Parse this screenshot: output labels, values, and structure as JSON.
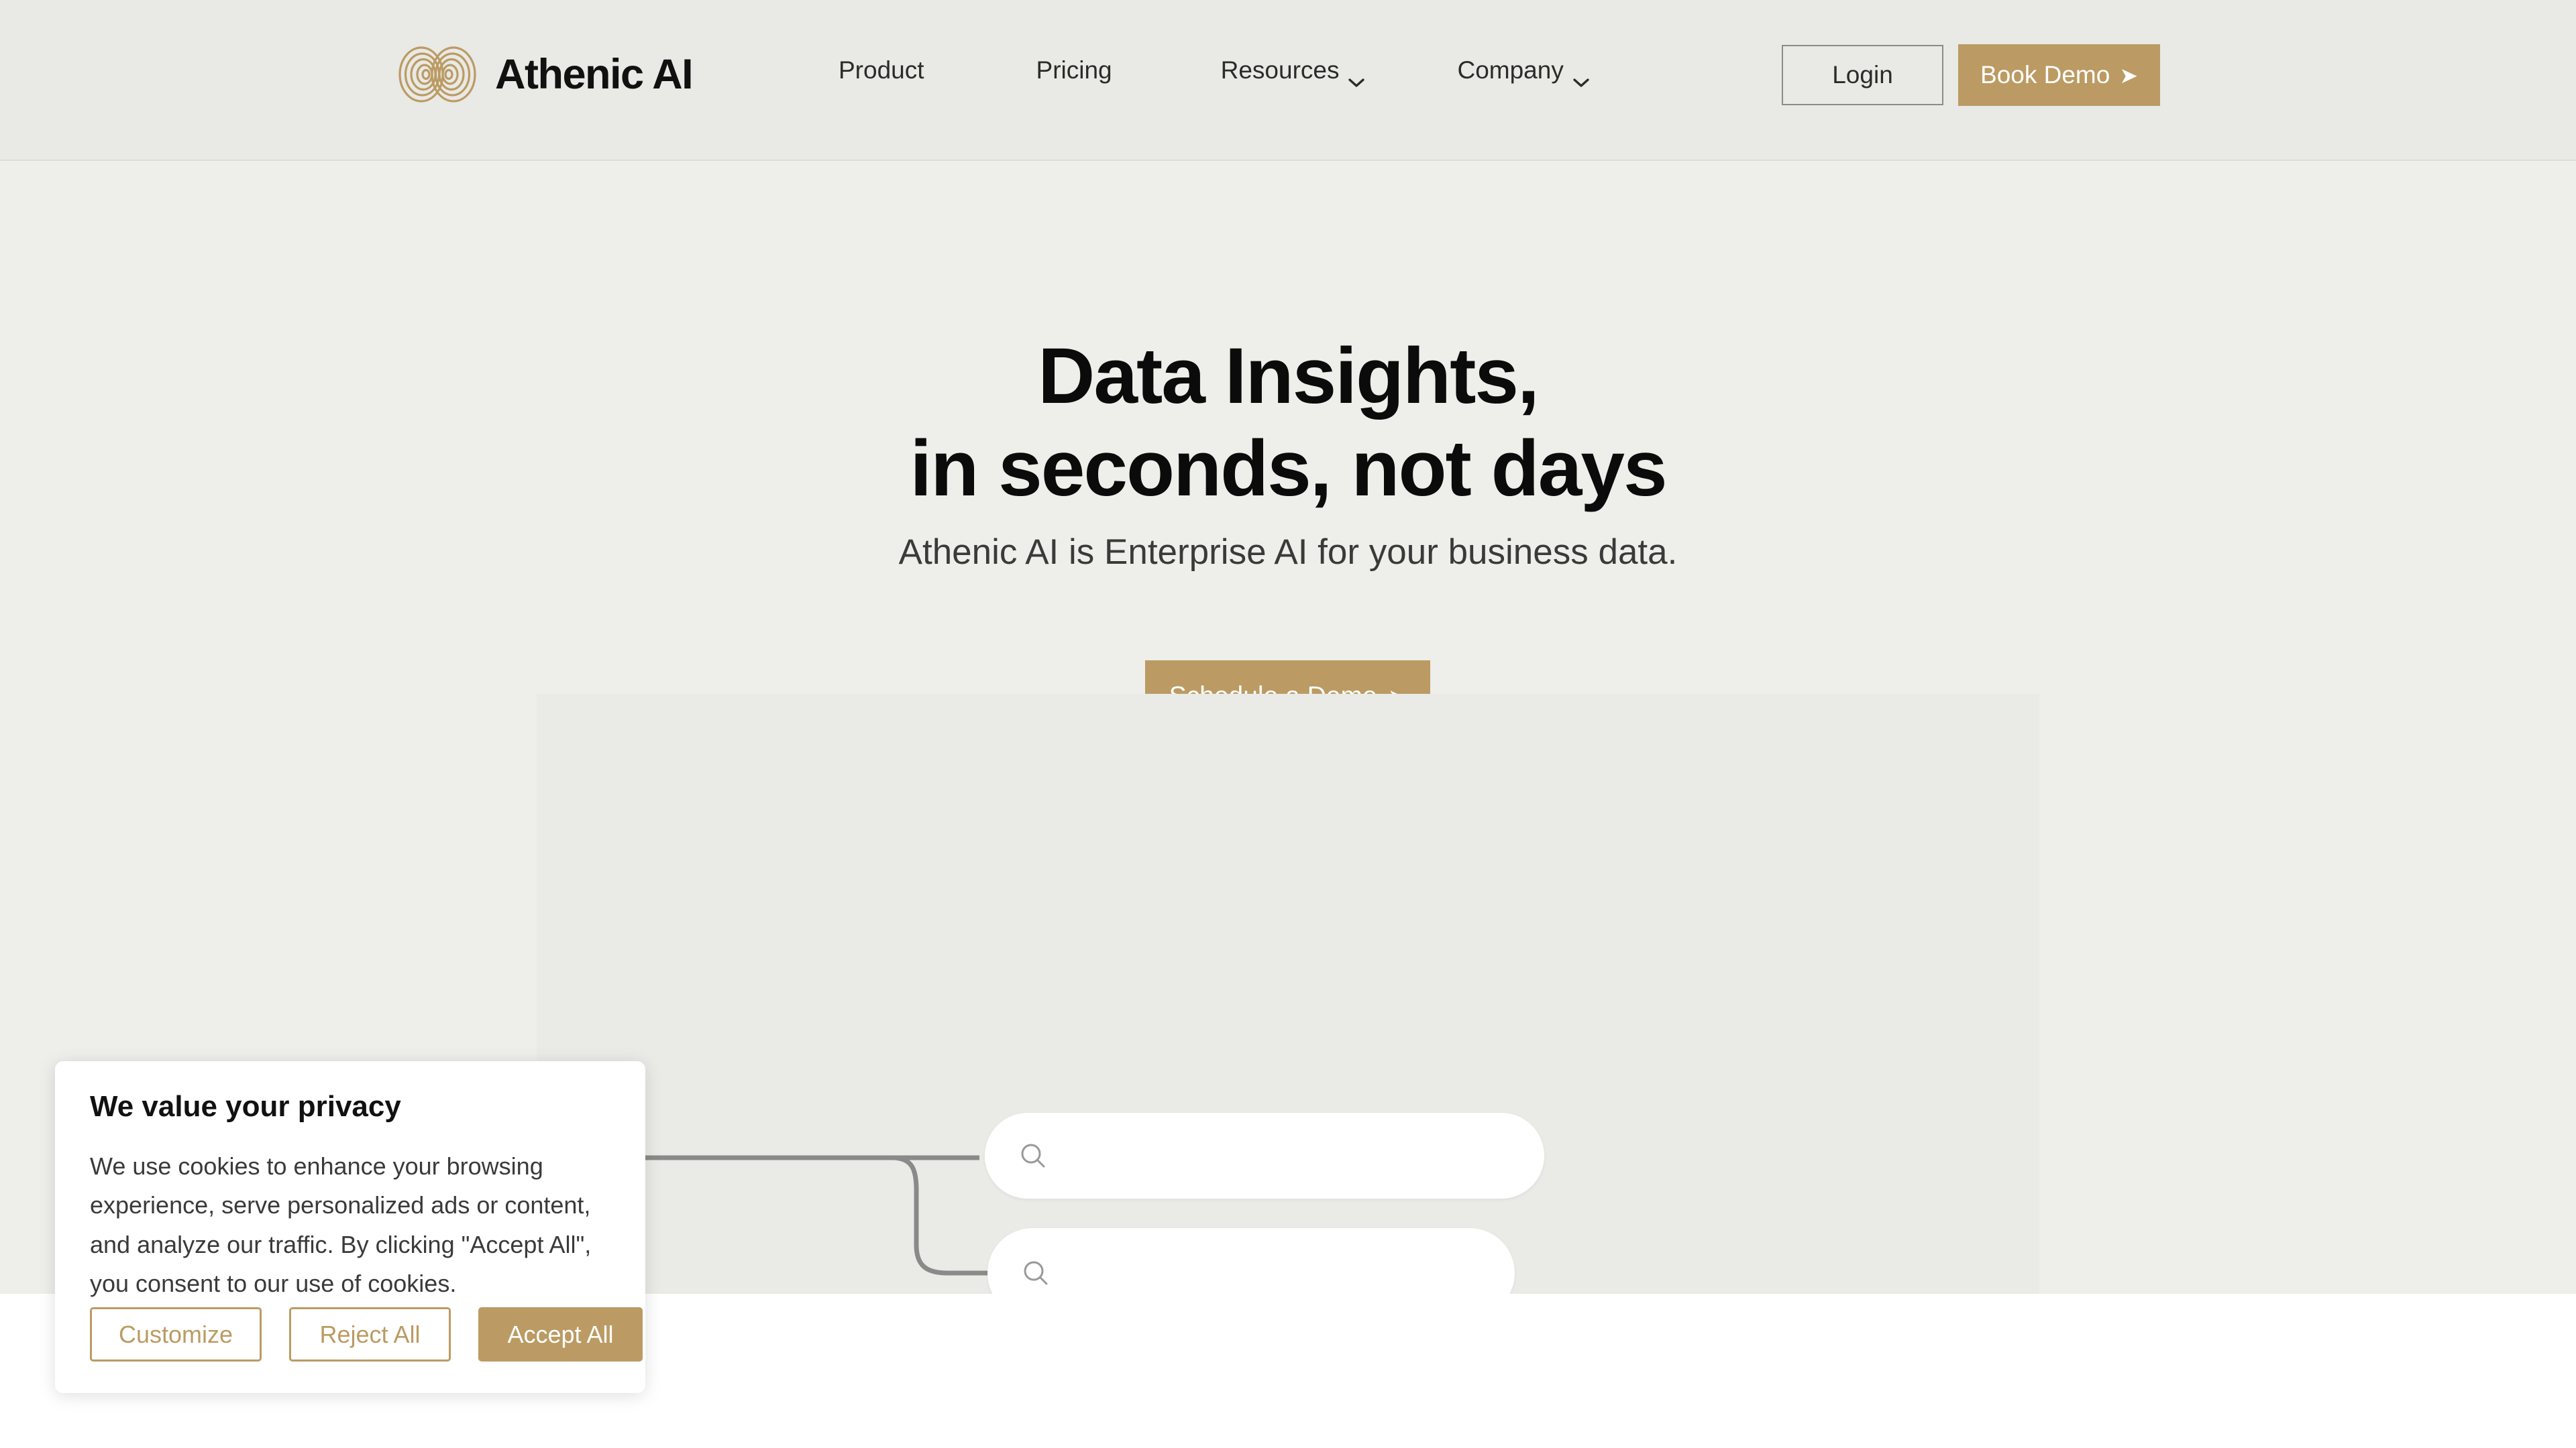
{
  "colors": {
    "accent_gold": "#bb9b63",
    "header_bg": "#e9e9e5",
    "hero_bg": "#eeeeea",
    "panel_bg": "#eaeae6",
    "page_bg": "#ffffff",
    "heading_text": "#0b0b0b",
    "body_text": "#3a3a3a",
    "connector_line": "#8a8a8a",
    "search_icon": "#999999",
    "login_border": "#8b8b88"
  },
  "header": {
    "logo_icon": "infinity-loops-icon",
    "brand_name": "Athenic AI",
    "nav": [
      {
        "label": "Product",
        "icon": null
      },
      {
        "label": "Pricing",
        "icon": null
      },
      {
        "label": "Resources",
        "icon": "chevron-down-icon"
      },
      {
        "label": "Company",
        "icon": "chevron-down-icon"
      }
    ],
    "login_label": "Login",
    "book_demo_label": "Book Demo",
    "book_demo_arrow": "➤"
  },
  "hero": {
    "title_line_1": "Data Insights,",
    "title_line_2": "in seconds, not days",
    "subtitle": "Athenic AI is Enterprise AI for your business data.",
    "cta_label": "Schedule a Demo",
    "cta_arrow": "➤"
  },
  "illustration": {
    "search_icon": "magnifier-icon",
    "search_bars": [
      {
        "value": "",
        "placeholder": ""
      },
      {
        "value": "",
        "placeholder": ""
      }
    ]
  },
  "cookie_banner": {
    "title": "We value your privacy",
    "body": "We use cookies to enhance your browsing experience, serve personalized ads or content, and analyze our traffic. By clicking \"Accept All\", you consent to our use of cookies.",
    "customize_label": "Customize",
    "reject_label": "Reject All",
    "accept_label": "Accept All"
  }
}
